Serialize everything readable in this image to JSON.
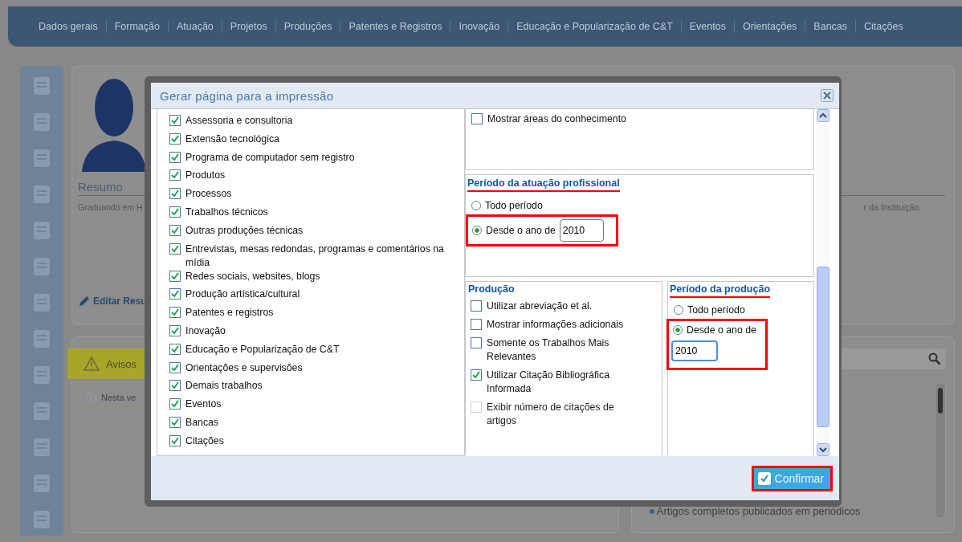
{
  "nav": [
    "Dados gerais",
    "Formação",
    "Atuação",
    "Projetos",
    "Produções",
    "Patentes e Registros",
    "Inovação",
    "Educação e Popularização de C&T",
    "Eventos",
    "Orientações",
    "Bancas",
    "Citações"
  ],
  "profile": {
    "section_title": "Resumo",
    "summary_start": "Graduando em H",
    "summary_end": "r da Instituição.",
    "edit_link": "Editar Resu"
  },
  "notices": {
    "title": "Avisos",
    "message": "Nesta ve"
  },
  "right_panel": {
    "list_item": "Artigos completos publicados em periódicos"
  },
  "dialog": {
    "title": "Gerar página para a impressão",
    "items": [
      {
        "label": "Assessoria e consultoria",
        "checked": true
      },
      {
        "label": "Extensão tecnológica",
        "checked": true
      },
      {
        "label": "Programa de computador sem registro",
        "checked": true
      },
      {
        "label": "Produtos",
        "checked": true
      },
      {
        "label": "Processos",
        "checked": true
      },
      {
        "label": "Trabalhos técnicos",
        "checked": true
      },
      {
        "label": "Outras produções técnicas",
        "checked": true
      },
      {
        "label": "Entrevistas, mesas redondas, programas e comentários na mídia",
        "checked": true
      },
      {
        "label": "Redes sociais, websites, blogs",
        "checked": true
      },
      {
        "label": "Produção artística/cultural",
        "checked": true
      },
      {
        "label": "Patentes e registros",
        "checked": true
      },
      {
        "label": "Inovação",
        "checked": true
      },
      {
        "label": "Educação e Popularização de C&T",
        "checked": true
      },
      {
        "label": "Orientações e supervisões",
        "checked": true
      },
      {
        "label": "Demais trabalhos",
        "checked": true
      },
      {
        "label": "Eventos",
        "checked": true
      },
      {
        "label": "Bancas",
        "checked": true
      },
      {
        "label": "Citações",
        "checked": true
      }
    ],
    "show_areas": {
      "label": "Mostrar áreas do conhecimento",
      "checked": false
    },
    "career_period": {
      "title": "Período da atuação profissional",
      "options": [
        {
          "label": "Todo período",
          "selected": false
        },
        {
          "label": "Desde o ano de",
          "selected": true
        }
      ],
      "year": "2010"
    },
    "production": {
      "title": "Produção",
      "options": [
        {
          "label": "Utilizar abreviação et al.",
          "checked": false,
          "disabled": false
        },
        {
          "label": "Mostrar informações adicionais",
          "checked": false,
          "disabled": false
        },
        {
          "label": "Somente os Trabalhos Mais Relevantes",
          "checked": false,
          "disabled": false
        },
        {
          "label": "Utilizar Citação Bibliográfica Informada",
          "checked": true,
          "disabled": false
        },
        {
          "label": "Exibir número de citações de artigos",
          "checked": false,
          "disabled": true
        }
      ]
    },
    "production_period": {
      "title": "Período da produção",
      "options": [
        {
          "label": "Todo período",
          "selected": false
        },
        {
          "label": "Desde o ano de",
          "selected": true
        }
      ],
      "year": "2010"
    },
    "confirm": "Confirmar"
  }
}
